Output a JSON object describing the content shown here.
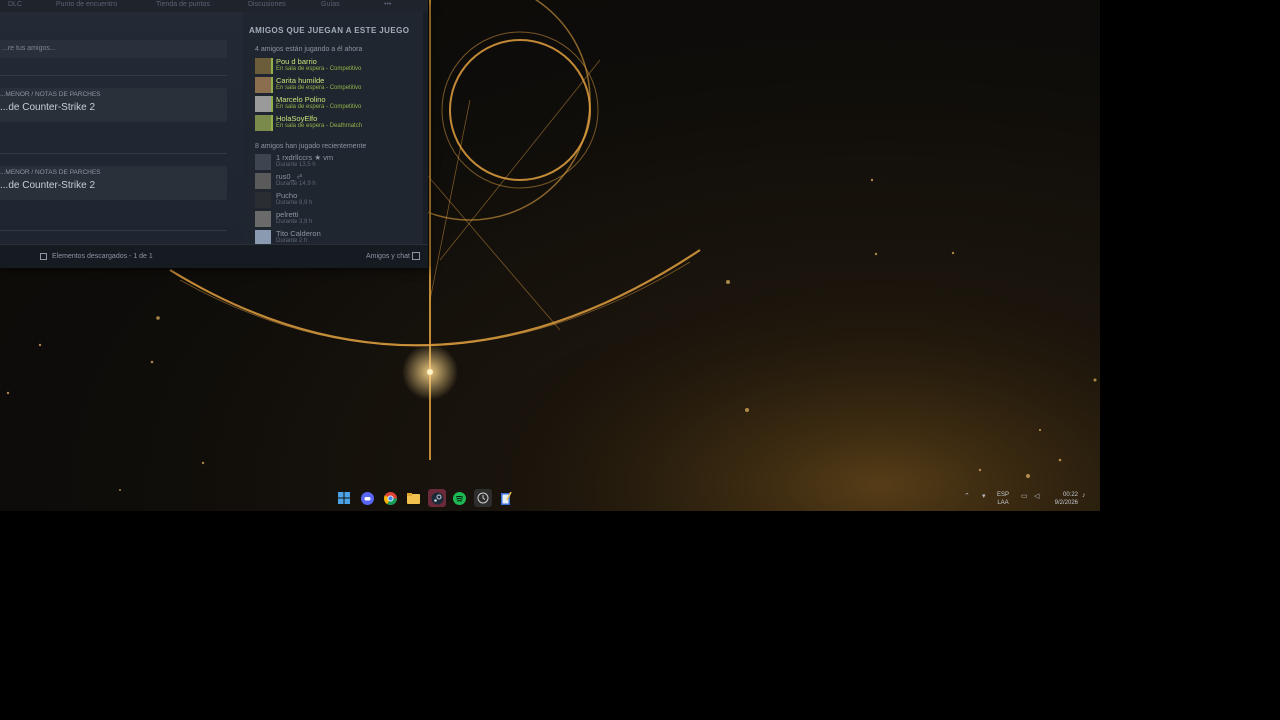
{
  "steam": {
    "tabs": [
      "DLC",
      "Punto de encuentro",
      "Tienda de puntos",
      "Discusiones",
      "Guías",
      "•••"
    ],
    "search_placeholder": "...re tus amigos...",
    "news": [
      {
        "kind": "...MENOR / NOTAS DE PARCHES",
        "title": "...de Counter-Strike 2"
      },
      {
        "kind": "...MENOR / NOTAS DE PARCHES",
        "title": "...de Counter-Strike 2"
      }
    ],
    "friends_panel": {
      "heading": "AMIGOS QUE JUEGAN A ESTE JUEGO",
      "playing_now_label": "4 amigos están jugando a él ahora",
      "playing_now": [
        {
          "name": "Pou d barrio",
          "status": "En sala de espera - Competitivo"
        },
        {
          "name": "Carita humilde",
          "status": "En sala de espera - Competitivo"
        },
        {
          "name": "Marcelo Polino",
          "status": "En sala de espera - Competitivo"
        },
        {
          "name": "HolaSoyElfo",
          "status": "En sala de espera - Deathmatch"
        }
      ],
      "recent_label": "8 amigos han jugado recientemente",
      "recent": [
        {
          "name": "1 rxdrllccrs ★ vm",
          "status": "Durante 13,5 h"
        },
        {
          "name": "rus0_ ‹³",
          "status": "Durante 14,9 h"
        },
        {
          "name": "Pucho",
          "status": "Durante 8,9 h"
        },
        {
          "name": "pelretti",
          "status": "Durante 3,9 h"
        },
        {
          "name": "Tito Calderon",
          "status": "Durante 2 h"
        }
      ]
    },
    "footer": {
      "downloads": "Elementos descargados - 1 de 1",
      "friends_chat": "Amigos y chat"
    }
  },
  "taskbar": {
    "apps": [
      "windows-start",
      "discord",
      "chrome",
      "file-explorer",
      "steam",
      "spotify",
      "clock-app",
      "notepad"
    ],
    "language": {
      "line1": "ESP",
      "line2": "LAA"
    },
    "time": "00:22",
    "date": "9/2/2026"
  },
  "colors": {
    "ingame_name": "#c7e37a",
    "ingame_status": "#8fb34a",
    "steam_bg": "#1b2029",
    "wallpaper_gold": "#f0b04a"
  }
}
